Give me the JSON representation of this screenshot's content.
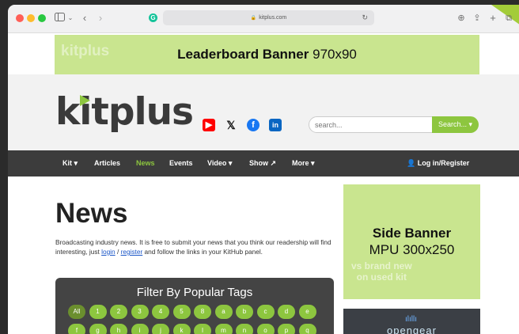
{
  "browser": {
    "url": "kitplus.com",
    "icons": {
      "sidebar": "sidebar-icon",
      "back": "chevron-left-icon",
      "forward": "chevron-right-icon",
      "download": "download-icon",
      "share": "share-icon",
      "new_tab": "plus-icon",
      "tabs": "tabs-icon",
      "reload": "reload-icon",
      "lock": "lock-icon"
    },
    "traffic_lights": [
      "#ff5f57",
      "#febc2e",
      "#28c840"
    ]
  },
  "leaderboard": {
    "title": "Leaderboard Banner",
    "size": "970x90"
  },
  "header": {
    "logo": "kitplus",
    "social": [
      "youtube-icon",
      "x-icon",
      "facebook-icon",
      "linkedin-icon"
    ],
    "search_placeholder": "search...",
    "search_button": "Search..."
  },
  "nav": {
    "items": [
      {
        "label": "Kit",
        "dropdown": true
      },
      {
        "label": "Articles",
        "dropdown": false
      },
      {
        "label": "News",
        "dropdown": false,
        "active": true
      },
      {
        "label": "Events",
        "dropdown": false
      },
      {
        "label": "Video",
        "dropdown": true
      },
      {
        "label": "Show",
        "dropdown": false,
        "external": true
      },
      {
        "label": "More",
        "dropdown": true
      }
    ],
    "login": "Log in/Register"
  },
  "main": {
    "title": "News",
    "intro_before": "Broadcasting industry news. It is free to submit your news that you think our readership will find interesting, just ",
    "login_link": "login",
    "sep": " / ",
    "register_link": "register",
    "intro_after": " and follow the links in your KitHub panel."
  },
  "filter": {
    "title": "Filter By Popular Tags",
    "row1": [
      "All",
      "1",
      "2",
      "3",
      "4",
      "5",
      "8",
      "a",
      "b",
      "c",
      "d",
      "e"
    ],
    "row2": [
      "f",
      "g",
      "h",
      "i",
      "j",
      "k",
      "l",
      "m",
      "n",
      "o",
      "p",
      "q"
    ]
  },
  "side_banner": {
    "title": "Side Banner",
    "size": "MPU 300x250"
  },
  "ad2": {
    "brand": "opengear"
  },
  "colors": {
    "accent": "#8dc63f",
    "banner": "#c9e58f",
    "nav_bg": "#3c3c3c"
  }
}
